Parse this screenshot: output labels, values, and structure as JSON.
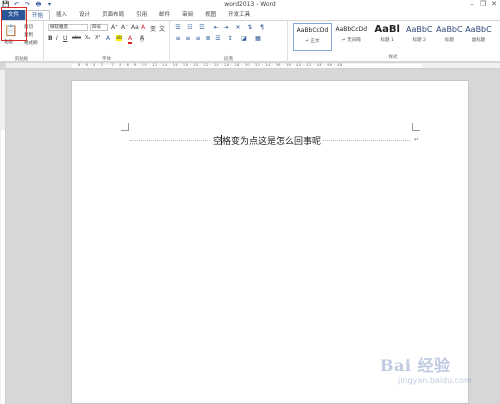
{
  "window": {
    "title": "word2013 - Word",
    "minimize_icon": "–",
    "restore_icon": "❐",
    "close_icon": "✕"
  },
  "qat": {
    "save_icon": "💾",
    "undo_icon": "↶",
    "redo_icon": "↷",
    "print_icon": "🖶",
    "customize_icon": "▾"
  },
  "tabs": [
    {
      "label": "文件"
    },
    {
      "label": "开始"
    },
    {
      "label": "插入"
    },
    {
      "label": "设计"
    },
    {
      "label": "页面布局"
    },
    {
      "label": "引用"
    },
    {
      "label": "邮件"
    },
    {
      "label": "审阅"
    },
    {
      "label": "视图"
    },
    {
      "label": "开发工具"
    }
  ],
  "clipboard": {
    "group_label": "剪贴板",
    "paste": "粘贴",
    "cut": "剪切",
    "copy": "复制",
    "format_painter": "格式刷"
  },
  "font": {
    "group_label": "字体",
    "font_name": "微软雅黑",
    "font_size": "四号",
    "bold": "B",
    "italic": "I",
    "underline": "U",
    "strikethrough": "abc",
    "subscript": "X₂",
    "superscript": "X²",
    "grow": "A⁺",
    "shrink": "A⁻",
    "case": "Aa",
    "clear": "A",
    "highlight": "ab",
    "color": "A",
    "char_shade": "A",
    "wen": "文",
    "pinyin": "变"
  },
  "paragraph": {
    "group_label": "段落"
  },
  "styles": {
    "group_label": "样式",
    "items": [
      {
        "preview": "AaBbCcDd",
        "name": "↵ 正文"
      },
      {
        "preview": "AaBbCcDd",
        "name": "↵ 无间隔"
      },
      {
        "preview": "AaBl",
        "name": "标题 1"
      },
      {
        "preview": "AaBbC",
        "name": "标题 2"
      },
      {
        "preview": "AaBbC",
        "name": "标题"
      },
      {
        "preview": "AaBbC",
        "name": "副标题"
      }
    ]
  },
  "ruler": {
    "numbers": "8 · 6 · 4 · 2 · · 2 · 4 · 6 · 8 · 10 · 12 · 14 · 16 · 18 · 20 · 22 · 24 · 26 · 28 · 30 · 32 · 34 · 36 · 38 · 40 · 42 · 44 · 46 · 48"
  },
  "document": {
    "text": "空格变为点这是怎么回事呢",
    "paragraph_mark": "↵"
  },
  "watermark": {
    "logo": "Bai 经验",
    "url": "jingyan.baidu.com"
  }
}
